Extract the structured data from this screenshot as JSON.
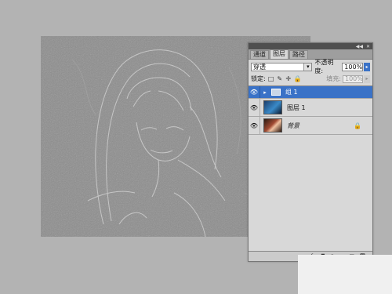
{
  "panel": {
    "tabs": [
      "通道",
      "图层",
      "路径"
    ],
    "active_tab": 1,
    "menu_icon": "▾≡",
    "blend_mode": "穿透",
    "opacity_label": "不透明度:",
    "opacity_value": "100%",
    "lock_label": "锁定:",
    "fill_label": "填充:",
    "fill_value": "100%",
    "layers": [
      {
        "name": "组 1",
        "kind": "group",
        "selected": true
      },
      {
        "name": "图层 1",
        "kind": "layer",
        "selected": false
      },
      {
        "name": "背景",
        "kind": "background",
        "selected": false
      }
    ]
  },
  "icons": {
    "eye": "👁",
    "collapse": "◀◀",
    "close": "✕",
    "expand": "▸",
    "dropdown": "▾",
    "arrow_right": "▸",
    "lock_transparent": "□",
    "lock_paint": "✎",
    "lock_move": "✛",
    "lock_all": "🔒",
    "link": "∞",
    "fx": "fx",
    "mask": "◘",
    "adjustment": "◑",
    "new_group": "▭",
    "new_layer": "▣",
    "trash": "🗑"
  },
  "colors": {
    "selection": "#3a72c7"
  }
}
